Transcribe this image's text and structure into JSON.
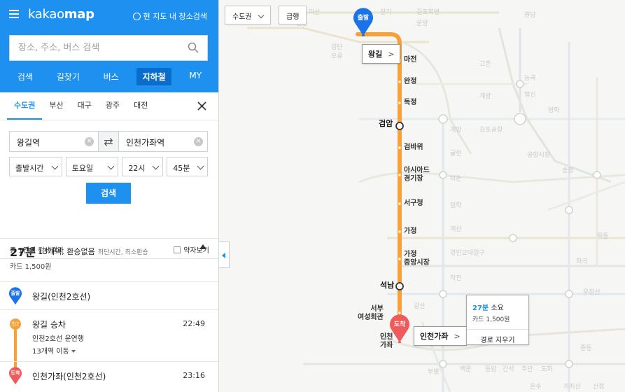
{
  "app": {
    "logo_prefix": "kakao",
    "logo_bold": "map",
    "map_search_toggle": "현 지도 내 장소검색"
  },
  "search": {
    "placeholder": "장소, 주소, 버스 검색"
  },
  "head_tabs": [
    "검색",
    "길찾기",
    "버스",
    "지하철",
    "MY"
  ],
  "active_head_tab": "지하철",
  "region_tabs": [
    "수도권",
    "부산",
    "대구",
    "광주",
    "대전"
  ],
  "active_region_tab": "수도권",
  "route_form": {
    "origin": "왕길역",
    "destination": "인천가좌역",
    "swap_symbol": "⇄",
    "time_type": "출발시간",
    "day": "토요일",
    "hour": "22시",
    "minute": "45분",
    "search_label": "검색"
  },
  "results": {
    "count_text": "총 1건의 검색결과",
    "brief_view_label": "약자보기"
  },
  "route": {
    "duration": "27분",
    "summary": "13개역, 환승없음",
    "summary_sub": "최단시간, 최소환승",
    "fare": "카드 1,500원",
    "steps": {
      "start_badge": "출발",
      "start_name": "왕길(인천2호선)",
      "line_badge": "인2",
      "board_title": "왕길 승차",
      "board_time": "22:49",
      "board_line": "인천2호선 운연행",
      "board_stops": "13개역 이동",
      "end_badge": "도착",
      "end_name": "인천가좌(인천2호선)",
      "end_time": "23:16"
    }
  },
  "map": {
    "area_select": "수도권",
    "exit_label": "급행",
    "start_pin": "출발",
    "end_pin": "도착",
    "callout_start": "왕길",
    "callout_end": "인천가좌",
    "stations": [
      "마전",
      "완정",
      "독정",
      "검암",
      "검바위",
      "아시아드\n경기장",
      "서구청",
      "가정",
      "가정\n중앙시장",
      "석남",
      "서부\n여성회관",
      "인천\n가좌"
    ],
    "info": {
      "duration": "27분",
      "duration_suffix": "소요",
      "fare": "카드 1,500원",
      "clear": "경로 지우기"
    },
    "faded_labels": [
      "구래",
      "양촌",
      "마산",
      "장기",
      "운양",
      "걸포북변",
      "검단\n오류",
      "고촌",
      "계양",
      "김포공항",
      "귤현",
      "박촌",
      "임학",
      "계산",
      "경인교대입구",
      "작전",
      "갈산",
      "부평구청",
      "부평시장",
      "부평",
      "백운",
      "동암",
      "간석",
      "주안",
      "도화",
      "제물포",
      "도원",
      "송내",
      "부천",
      "중동",
      "소사",
      "온수",
      "까치산",
      "신정",
      "목동",
      "화곡",
      "우장산",
      "발산",
      "마곡",
      "송정",
      "공항시장",
      "방화",
      "개화",
      "능곡",
      "행신",
      "원당"
    ]
  },
  "colors": {
    "brand": "#1e90f0",
    "line_orange": "#f5a23d",
    "end_red": "#ef5b5b"
  }
}
